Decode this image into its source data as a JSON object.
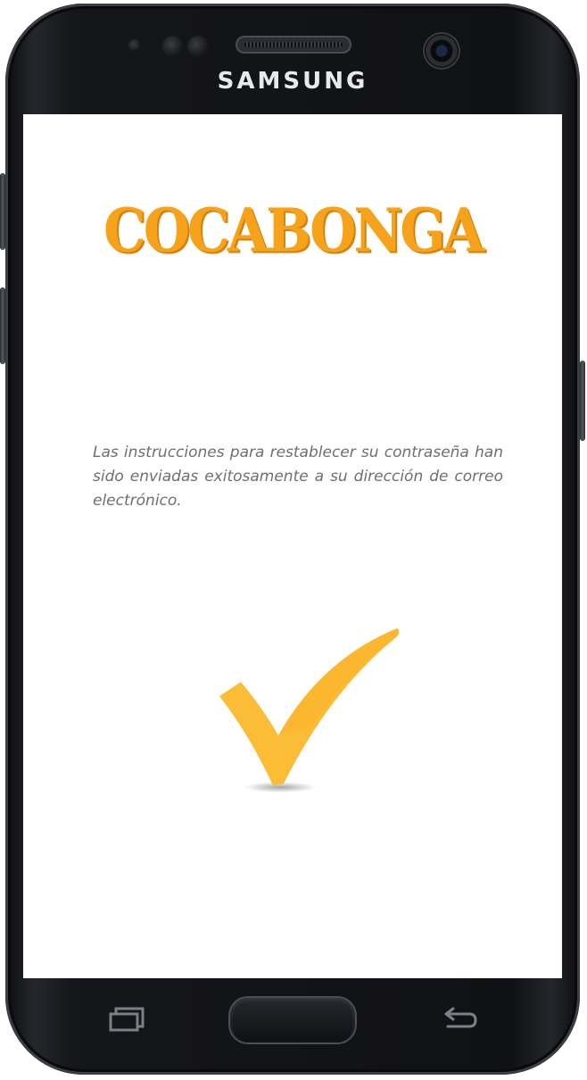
{
  "device": {
    "brand": "SAMSUNG"
  },
  "app": {
    "logo_text": "COCABONGA",
    "message": "Las instrucciones para restablecer su contraseña han sido enviadas exitosamente a su dirección de correo electrónico.",
    "success_icon": "checkmark-icon"
  },
  "navbar": {
    "recent_icon": "recent-apps-icon",
    "home_icon": "home-button",
    "back_icon": "back-icon"
  },
  "colors": {
    "logo": "#f7a21b",
    "checkmark": "#fbbd35",
    "message_text": "#6f6f6f",
    "bezel": "#15161a"
  }
}
